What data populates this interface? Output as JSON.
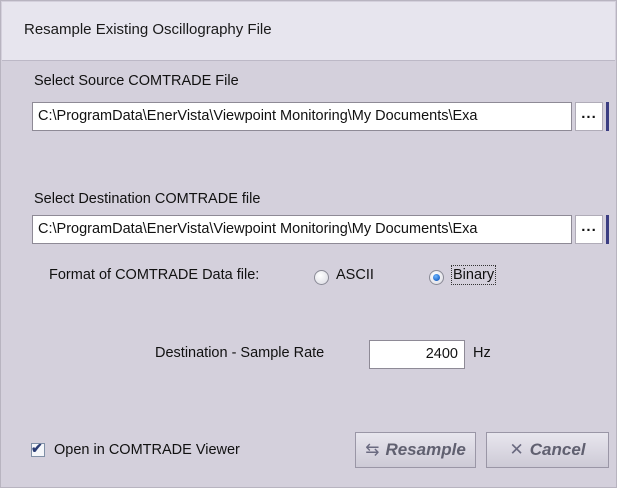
{
  "window": {
    "title": "Resample Existing Oscillography File"
  },
  "source": {
    "label": "Select Source COMTRADE File",
    "path": "C:\\ProgramData\\EnerVista\\Viewpoint Monitoring\\My Documents\\Exa",
    "browse_label": "..."
  },
  "destination": {
    "label": "Select Destination COMTRADE file",
    "path": "C:\\ProgramData\\EnerVista\\Viewpoint Monitoring\\My Documents\\Exa",
    "browse_label": "..."
  },
  "format": {
    "label": "Format of COMTRADE Data file:",
    "options": [
      {
        "label": "ASCII",
        "selected": false
      },
      {
        "label": "Binary",
        "selected": true
      }
    ]
  },
  "sample_rate": {
    "label": "Destination  - Sample Rate",
    "value": "2400",
    "unit": "Hz"
  },
  "open_viewer": {
    "label": "Open in COMTRADE Viewer",
    "checked": true
  },
  "buttons": {
    "resample_label": "Resample",
    "cancel_label": "Cancel"
  },
  "icons": {
    "browse": "ellipsis-icon",
    "resample": "refresh-arrows-icon",
    "cancel": "x-icon",
    "checkbox": "checkmark-icon"
  },
  "colors": {
    "dialog_bg": "#d4d0dc",
    "accent_edge": "#3b3d82",
    "radio_selected": "#1f67c9"
  }
}
